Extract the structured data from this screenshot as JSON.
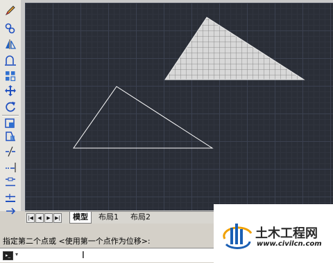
{
  "tabs": {
    "model": "模型",
    "layout1": "布局1",
    "layout2": "布局2"
  },
  "command": {
    "prompt": "指定第二个点或 <使用第一个点作为位移>:"
  },
  "logo": {
    "name": "土木工程网",
    "url": "www.civilcn.com"
  },
  "colors": {
    "canvas_bg": "#2a2e37",
    "grid_major": "#3b4150",
    "shape_line": "#ffffff",
    "hatch_fill": "#d8d8d8",
    "logo_blue": "#1a5fb4"
  },
  "toolbar": {
    "icons": [
      "pencil-icon",
      "copy-icon",
      "mirror-icon",
      "offset-icon",
      "array-icon",
      "move-icon",
      "rotate-icon",
      "scale-icon",
      "stretch-icon",
      "trim-icon",
      "extend-icon",
      "break-icon",
      "join-icon",
      "chamfer-icon",
      "explode-icon"
    ]
  }
}
